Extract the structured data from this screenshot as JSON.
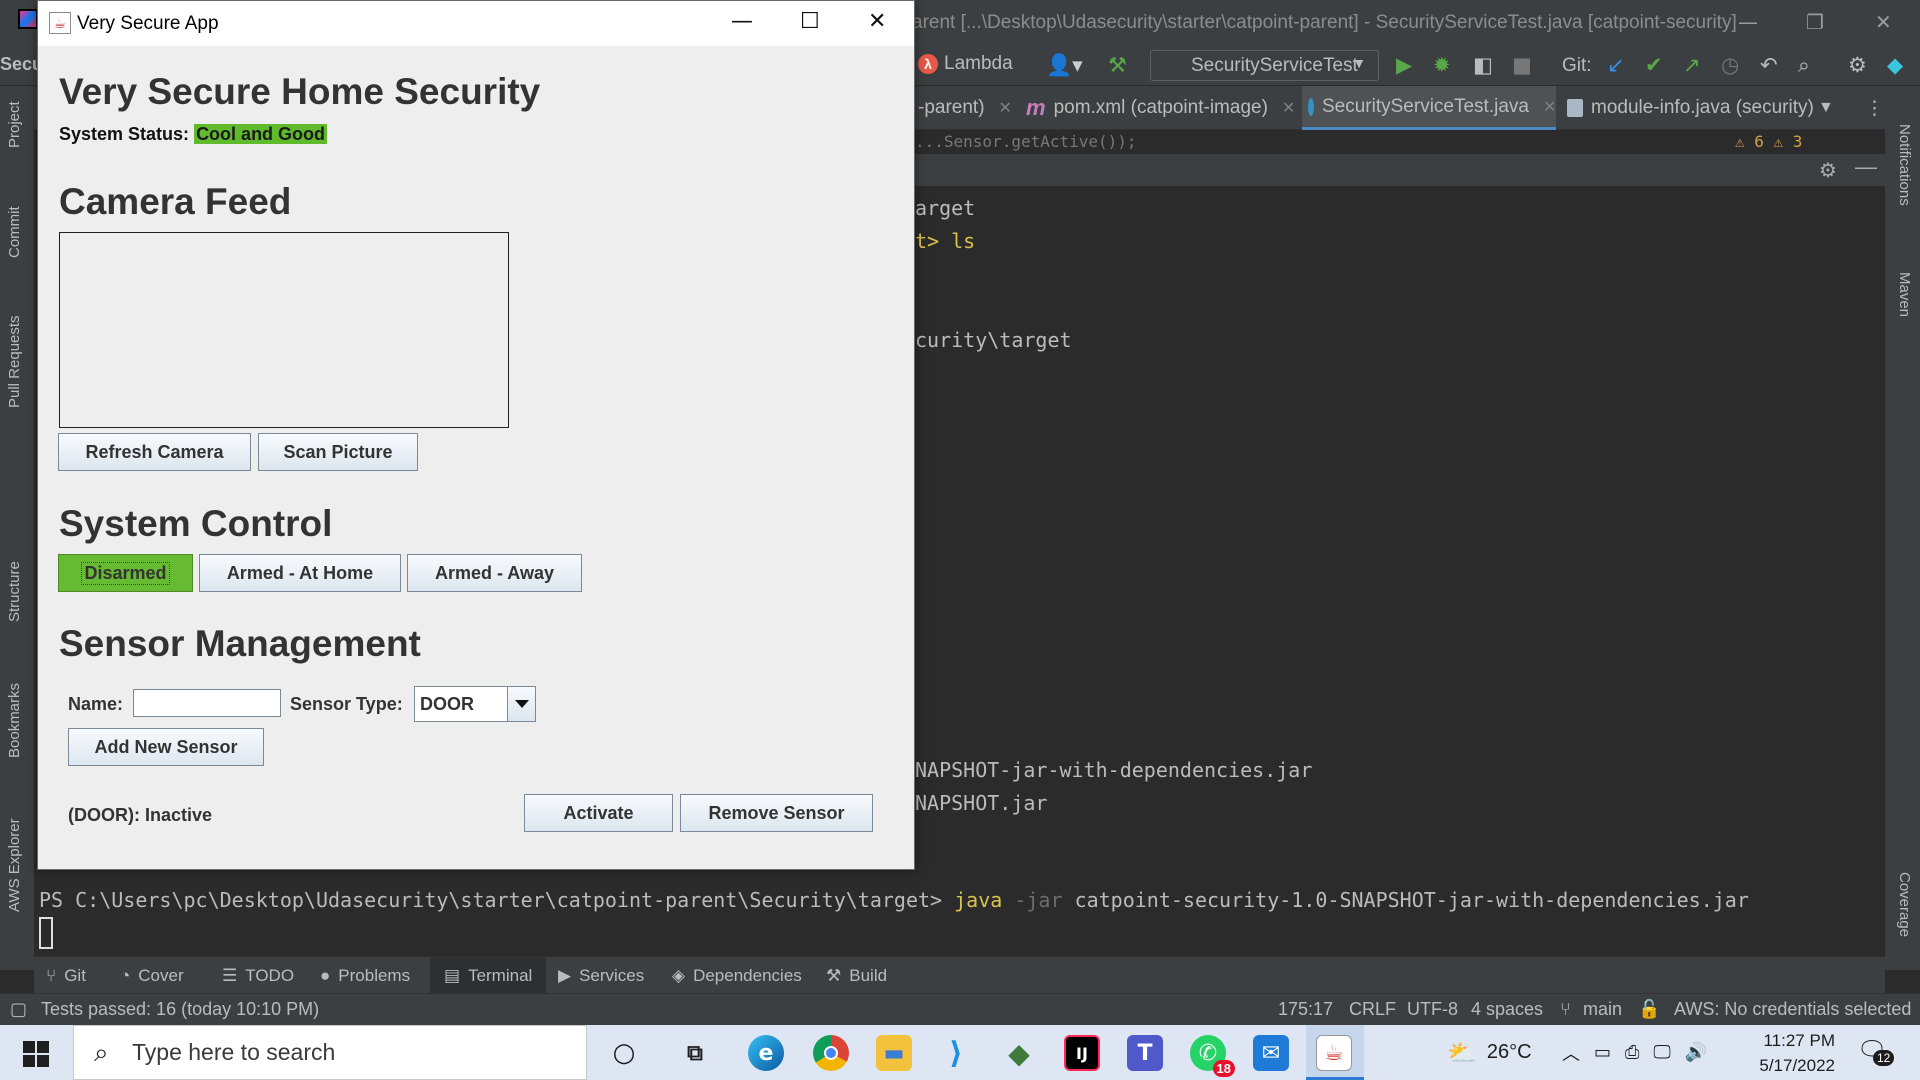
{
  "ide": {
    "title": "arent [...\\Desktop\\Udasecurity\\starter\\catpoint-parent] - SecurityServiceTest.java [catpoint-security]",
    "toolbar_left_label": "Secu",
    "lambda_label": "Lambda",
    "run_config": "SecurityServiceTest",
    "git_label": "Git:",
    "tabs": [
      {
        "label": "-parent)"
      },
      {
        "label": "pom.xml (catpoint-image)"
      },
      {
        "label": "SecurityServiceTest.java"
      },
      {
        "label": "module-info.java (security)"
      }
    ],
    "editor_snippet": "...Sensor.getActive());",
    "warnings": "⚠ 6  ⚠ 3",
    "left_tools": [
      "Project",
      "Commit",
      "Pull Requests",
      "Structure",
      "Bookmarks",
      "AWS Explorer"
    ],
    "right_tools": [
      "Notifications",
      "Maven",
      "Coverage"
    ],
    "terminal_lines": [
      "arget",
      "t> ls",
      "curity\\target",
      "NAPSHOT-jar-with-dependencies.jar",
      "NAPSHOT.jar"
    ],
    "terminal_prompt": "PS C:\\Users\\pc\\Desktop\\Udasecurity\\starter\\catpoint-parent\\Security\\target>",
    "terminal_cmd": "java",
    "terminal_flag": "-jar",
    "terminal_arg": "catpoint-security-1.0-SNAPSHOT-jar-with-dependencies.jar",
    "bottom_tabs": [
      "Git",
      "Cover",
      "TODO",
      "Problems",
      "Terminal",
      "Services",
      "Dependencies",
      "Build"
    ],
    "status_left": "Tests passed: 16 (today 10:10 PM)",
    "status_pos": "175:17",
    "status_eol": "CRLF",
    "status_enc": "UTF-8",
    "status_indent": "4 spaces",
    "status_branch": "main",
    "status_aws": "AWS: No credentials selected"
  },
  "app": {
    "window_title": "Very Secure App",
    "heading": "Very Secure Home Security",
    "status_label": "System Status:",
    "status_value": "Cool and Good",
    "status_color": "#5fba2c",
    "camera_heading": "Camera Feed",
    "refresh_camera": "Refresh Camera",
    "scan_picture": "Scan Picture",
    "control_heading": "System Control",
    "disarmed": "Disarmed",
    "armed_home": "Armed - At Home",
    "armed_away": "Armed - Away",
    "active_color": "#66bb33",
    "sensor_heading": "Sensor Management",
    "name_label": "Name:",
    "name_value": "",
    "sensor_type_label": "Sensor Type:",
    "sensor_type_value": "DOOR",
    "add_sensor": "Add New Sensor",
    "sensor_row": {
      "description": "(DOOR): Inactive",
      "activate": "Activate",
      "remove": "Remove Sensor"
    }
  },
  "taskbar": {
    "search_placeholder": "Type here to search",
    "whatsapp_badge": "18",
    "temperature": "26°C",
    "time": "11:27 PM",
    "date": "5/17/2022",
    "notification_count": "12"
  }
}
